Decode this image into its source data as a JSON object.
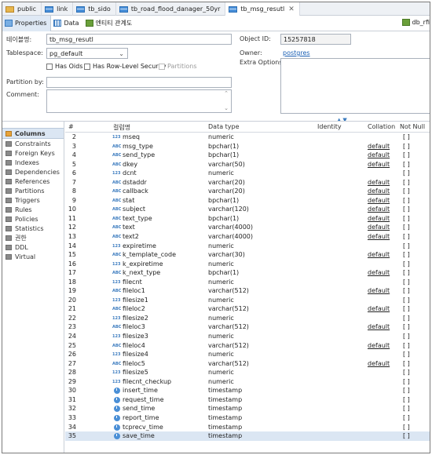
{
  "editor_tabs": [
    {
      "label": "public",
      "active": false,
      "icon": "folder-icon"
    },
    {
      "label": "link",
      "active": false,
      "icon": "table-icon"
    },
    {
      "label": "tb_sido",
      "active": false,
      "icon": "table-icon"
    },
    {
      "label": "tb_road_flood_danager_50yr",
      "active": false,
      "icon": "table-icon"
    },
    {
      "label": "tb_msg_resutl",
      "active": true,
      "icon": "table-icon"
    }
  ],
  "subtabs": {
    "properties": "Properties",
    "data": "Data",
    "er": "엔티티 관계도"
  },
  "db_ref": "db_rfi",
  "form": {
    "table_name_label": "테이블명:",
    "table_name": "tb_msg_resutl",
    "tablespace_label": "Tablespace:",
    "tablespace": "pg_default",
    "has_oids": "Has Oids",
    "has_rls": "Has Row-Level Security",
    "partitions": "Partitions",
    "partition_by_label": "Partition by:",
    "comment_label": "Comment:",
    "object_id_label": "Object ID:",
    "object_id": "15257818",
    "owner_label": "Owner:",
    "owner": "postgres",
    "extra_options_label": "Extra Options:"
  },
  "nav": [
    {
      "label": "Columns",
      "active": true
    },
    {
      "label": "Constraints",
      "active": false
    },
    {
      "label": "Foreign Keys",
      "active": false
    },
    {
      "label": "Indexes",
      "active": false
    },
    {
      "label": "Dependencies",
      "active": false
    },
    {
      "label": "References",
      "active": false
    },
    {
      "label": "Partitions",
      "active": false
    },
    {
      "label": "Triggers",
      "active": false
    },
    {
      "label": "Rules",
      "active": false
    },
    {
      "label": "Policies",
      "active": false
    },
    {
      "label": "Statistics",
      "active": false
    },
    {
      "label": "권한",
      "active": false
    },
    {
      "label": "DDL",
      "active": false
    },
    {
      "label": "Virtual",
      "active": false
    }
  ],
  "columns_header": {
    "num": "#",
    "name": "컬럼명",
    "type": "Data type",
    "identity": "Identity",
    "collation": "Collation",
    "notnull": "Not Null"
  },
  "columns": [
    {
      "n": "2",
      "kind": "num",
      "name": "mseq",
      "type": "numeric",
      "collation": "",
      "notnull": "[ ]"
    },
    {
      "n": "3",
      "kind": "str",
      "name": "msg_type",
      "type": "bpchar(1)",
      "collation": "default",
      "notnull": "[ ]"
    },
    {
      "n": "4",
      "kind": "str",
      "name": "send_type",
      "type": "bpchar(1)",
      "collation": "default",
      "notnull": "[ ]"
    },
    {
      "n": "5",
      "kind": "str",
      "name": "dkey",
      "type": "varchar(50)",
      "collation": "default",
      "notnull": "[ ]"
    },
    {
      "n": "6",
      "kind": "num",
      "name": "dcnt",
      "type": "numeric",
      "collation": "",
      "notnull": "[ ]"
    },
    {
      "n": "7",
      "kind": "str",
      "name": "dstaddr",
      "type": "varchar(20)",
      "collation": "default",
      "notnull": "[ ]"
    },
    {
      "n": "8",
      "kind": "str",
      "name": "callback",
      "type": "varchar(20)",
      "collation": "default",
      "notnull": "[ ]"
    },
    {
      "n": "9",
      "kind": "str",
      "name": "stat",
      "type": "bpchar(1)",
      "collation": "default",
      "notnull": "[ ]"
    },
    {
      "n": "10",
      "kind": "str",
      "name": "subject",
      "type": "varchar(120)",
      "collation": "default",
      "notnull": "[ ]"
    },
    {
      "n": "11",
      "kind": "str",
      "name": "text_type",
      "type": "bpchar(1)",
      "collation": "default",
      "notnull": "[ ]"
    },
    {
      "n": "12",
      "kind": "str",
      "name": "text",
      "type": "varchar(4000)",
      "collation": "default",
      "notnull": "[ ]"
    },
    {
      "n": "13",
      "kind": "str",
      "name": "text2",
      "type": "varchar(4000)",
      "collation": "default",
      "notnull": "[ ]"
    },
    {
      "n": "14",
      "kind": "num",
      "name": "expiretime",
      "type": "numeric",
      "collation": "",
      "notnull": "[ ]"
    },
    {
      "n": "15",
      "kind": "str",
      "name": "k_template_code",
      "type": "varchar(30)",
      "collation": "default",
      "notnull": "[ ]"
    },
    {
      "n": "16",
      "kind": "num",
      "name": "k_expiretime",
      "type": "numeric",
      "collation": "",
      "notnull": "[ ]"
    },
    {
      "n": "17",
      "kind": "str",
      "name": "k_next_type",
      "type": "bpchar(1)",
      "collation": "default",
      "notnull": "[ ]"
    },
    {
      "n": "18",
      "kind": "num",
      "name": "filecnt",
      "type": "numeric",
      "collation": "",
      "notnull": "[ ]"
    },
    {
      "n": "19",
      "kind": "str",
      "name": "fileloc1",
      "type": "varchar(512)",
      "collation": "default",
      "notnull": "[ ]"
    },
    {
      "n": "20",
      "kind": "num",
      "name": "filesize1",
      "type": "numeric",
      "collation": "",
      "notnull": "[ ]"
    },
    {
      "n": "21",
      "kind": "str",
      "name": "fileloc2",
      "type": "varchar(512)",
      "collation": "default",
      "notnull": "[ ]"
    },
    {
      "n": "22",
      "kind": "num",
      "name": "filesize2",
      "type": "numeric",
      "collation": "",
      "notnull": "[ ]"
    },
    {
      "n": "23",
      "kind": "str",
      "name": "fileloc3",
      "type": "varchar(512)",
      "collation": "default",
      "notnull": "[ ]"
    },
    {
      "n": "24",
      "kind": "num",
      "name": "filesize3",
      "type": "numeric",
      "collation": "",
      "notnull": "[ ]"
    },
    {
      "n": "25",
      "kind": "str",
      "name": "fileloc4",
      "type": "varchar(512)",
      "collation": "default",
      "notnull": "[ ]"
    },
    {
      "n": "26",
      "kind": "num",
      "name": "filesize4",
      "type": "numeric",
      "collation": "",
      "notnull": "[ ]"
    },
    {
      "n": "27",
      "kind": "str",
      "name": "fileloc5",
      "type": "varchar(512)",
      "collation": "default",
      "notnull": "[ ]"
    },
    {
      "n": "28",
      "kind": "num",
      "name": "filesize5",
      "type": "numeric",
      "collation": "",
      "notnull": "[ ]"
    },
    {
      "n": "29",
      "kind": "num",
      "name": "filecnt_checkup",
      "type": "numeric",
      "collation": "",
      "notnull": "[ ]"
    },
    {
      "n": "30",
      "kind": "time",
      "name": "insert_time",
      "type": "timestamp",
      "collation": "",
      "notnull": "[ ]"
    },
    {
      "n": "31",
      "kind": "time",
      "name": "request_time",
      "type": "timestamp",
      "collation": "",
      "notnull": "[ ]"
    },
    {
      "n": "32",
      "kind": "time",
      "name": "send_time",
      "type": "timestamp",
      "collation": "",
      "notnull": "[ ]"
    },
    {
      "n": "33",
      "kind": "time",
      "name": "report_time",
      "type": "timestamp",
      "collation": "",
      "notnull": "[ ]"
    },
    {
      "n": "34",
      "kind": "time",
      "name": "tcprecv_time",
      "type": "timestamp",
      "collation": "",
      "notnull": "[ ]"
    },
    {
      "n": "35",
      "kind": "time",
      "name": "save_time",
      "type": "timestamp",
      "collation": "",
      "notnull": "[ ]",
      "selected": true
    }
  ],
  "type_badges": {
    "num": "123",
    "str": "ABC"
  }
}
